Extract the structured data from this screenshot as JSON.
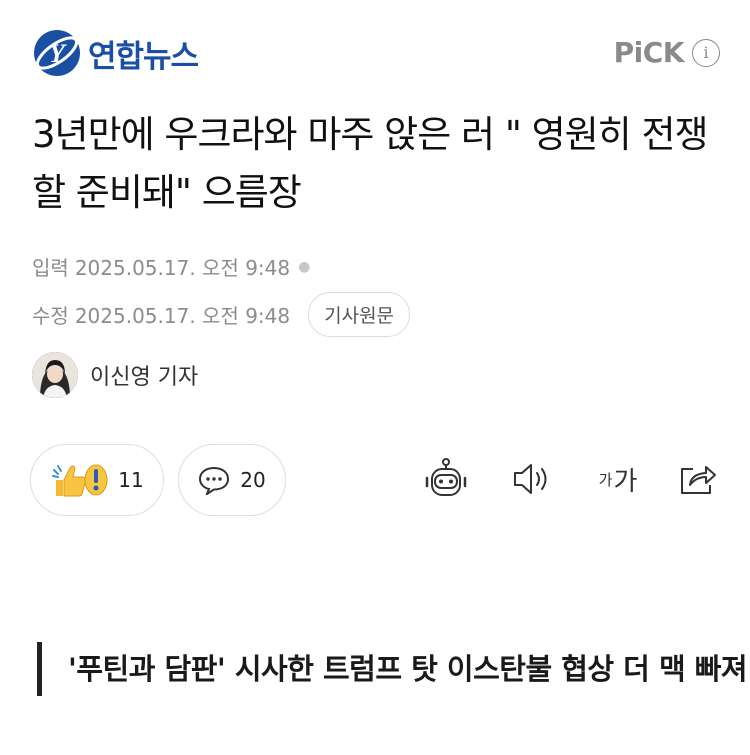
{
  "header": {
    "brand_name": "연합뉴스",
    "brand_color": "#1a4fa3",
    "pick_label": "PiCK",
    "info_icon": "info-icon"
  },
  "article": {
    "headline": "3년만에 우크라와 마주 앉은 러 \" 영원히 전쟁할 준비돼\" 으름장",
    "input_label": "입력",
    "input_time": "2025.05.17. 오전 9:48",
    "modified_label": "수정",
    "modified_time": "2025.05.17. 오전 9:48",
    "original_button": "기사원문",
    "author": "이신영 기자"
  },
  "actions": {
    "reaction_count": "11",
    "comment_count": "20",
    "font_small": "가",
    "font_big": "가",
    "icons": [
      "reaction-thumbs-icon",
      "comment-bubble-icon",
      "ai-bot-icon",
      "speaker-icon",
      "font-size-icon",
      "share-icon"
    ]
  },
  "summary": {
    "quote": "'푸틴과 담판' 시사한 트럼프 탓 이스탄불 협상 더 맥 빠져"
  }
}
